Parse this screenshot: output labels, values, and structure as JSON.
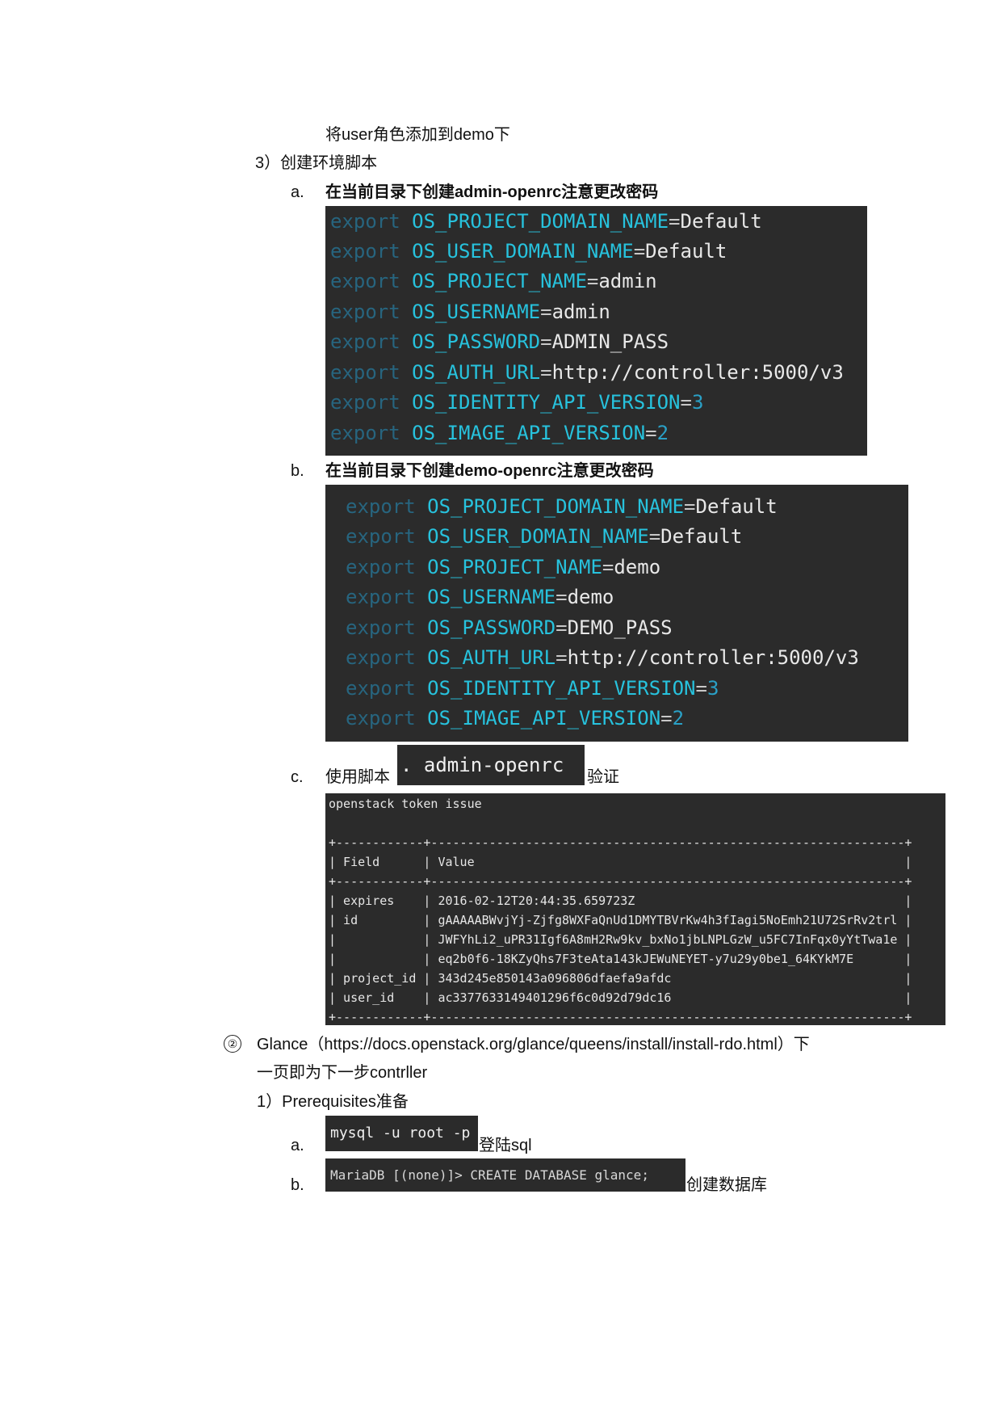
{
  "step_user_role": "将user角色添加到demo下",
  "step3": {
    "title": "3）创建环境脚本",
    "a": {
      "marker": "a.",
      "text": "在当前目录下创建admin-openrc注意更改密码",
      "lines": [
        {
          "kw": "export",
          "var": "OS_PROJECT_DOMAIN_NAME",
          "eq": "=",
          "val": "Default",
          "num": ""
        },
        {
          "kw": "export",
          "var": "OS_USER_DOMAIN_NAME",
          "eq": "=",
          "val": "Default",
          "num": ""
        },
        {
          "kw": "export",
          "var": "OS_PROJECT_NAME",
          "eq": "=",
          "val": "admin",
          "num": ""
        },
        {
          "kw": "export",
          "var": "OS_USERNAME",
          "eq": "=",
          "val": "admin",
          "num": ""
        },
        {
          "kw": "export",
          "var": "OS_PASSWORD",
          "eq": "=",
          "val": "ADMIN_PASS",
          "num": ""
        },
        {
          "kw": "export",
          "var": "OS_AUTH_URL",
          "eq": "=",
          "val": "http://controller:5000/v3",
          "num": ""
        },
        {
          "kw": "export",
          "var": "OS_IDENTITY_API_VERSION",
          "eq": "=",
          "val": "",
          "num": "3"
        },
        {
          "kw": "export",
          "var": "OS_IMAGE_API_VERSION",
          "eq": "=",
          "val": "",
          "num": "2"
        }
      ]
    },
    "b": {
      "marker": "b.",
      "text": "在当前目录下创建demo-openrc注意更改密码",
      "lines": [
        {
          "kw": "export",
          "var": "OS_PROJECT_DOMAIN_NAME",
          "eq": "=",
          "val": "Default",
          "num": ""
        },
        {
          "kw": "export",
          "var": "OS_USER_DOMAIN_NAME",
          "eq": "=",
          "val": "Default",
          "num": ""
        },
        {
          "kw": "export",
          "var": "OS_PROJECT_NAME",
          "eq": "=",
          "val": "demo",
          "num": ""
        },
        {
          "kw": "export",
          "var": "OS_USERNAME",
          "eq": "=",
          "val": "demo",
          "num": ""
        },
        {
          "kw": "export",
          "var": "OS_PASSWORD",
          "eq": "=",
          "val": "DEMO_PASS",
          "num": ""
        },
        {
          "kw": "export",
          "var": "OS_AUTH_URL",
          "eq": "=",
          "val": "http://controller:5000/v3",
          "num": ""
        },
        {
          "kw": "export",
          "var": "OS_IDENTITY_API_VERSION",
          "eq": "=",
          "val": "",
          "num": "3"
        },
        {
          "kw": "export",
          "var": "OS_IMAGE_API_VERSION",
          "eq": "=",
          "val": "",
          "num": "2"
        }
      ]
    },
    "c": {
      "marker": "c.",
      "prefix": "使用脚本",
      "chip": ". admin-openrc",
      "suffix": "验证",
      "terminal_lines": [
        "openstack token issue",
        "",
        "+------------+-----------------------------------------------------------------+",
        "| Field      | Value                                                           |",
        "+------------+-----------------------------------------------------------------+",
        "| expires    | 2016-02-12T20:44:35.659723Z                                     |",
        "| id         | gAAAAABWvjYj-Zjfg8WXFaQnUd1DMYTBVrKw4h3fIagi5NoEmh21U72SrRv2trl |",
        "|            | JWFYhLi2_uPR31Igf6A8mH2Rw9kv_bxNo1jbLNPLGzW_u5FC7InFqx0yYtTwa1e |",
        "|            | eq2b0f6-18KZyQhs7F3teAta143kJEWuNEYET-y7u29y0be1_64KYkM7E       |",
        "| project_id | 343d245e850143a096806dfaefa9afdc                                |",
        "| user_id    | ac3377633149401296f6c0d92d79dc16                                |",
        "+------------+-----------------------------------------------------------------+"
      ]
    }
  },
  "glance": {
    "marker": "②",
    "line1": "Glance（https://docs.openstack.org/glance/queens/install/install-rdo.html）下",
    "line2": "一页即为下一步contrller",
    "prereq_title": "1）Prerequisites准备",
    "a": {
      "marker": "a.",
      "chip": "mysql -u root -p",
      "suffix": "登陆sql"
    },
    "b": {
      "marker": "b.",
      "chip": "MariaDB [(none)]> CREATE DATABASE glance;",
      "suffix": "创建数据库"
    }
  }
}
